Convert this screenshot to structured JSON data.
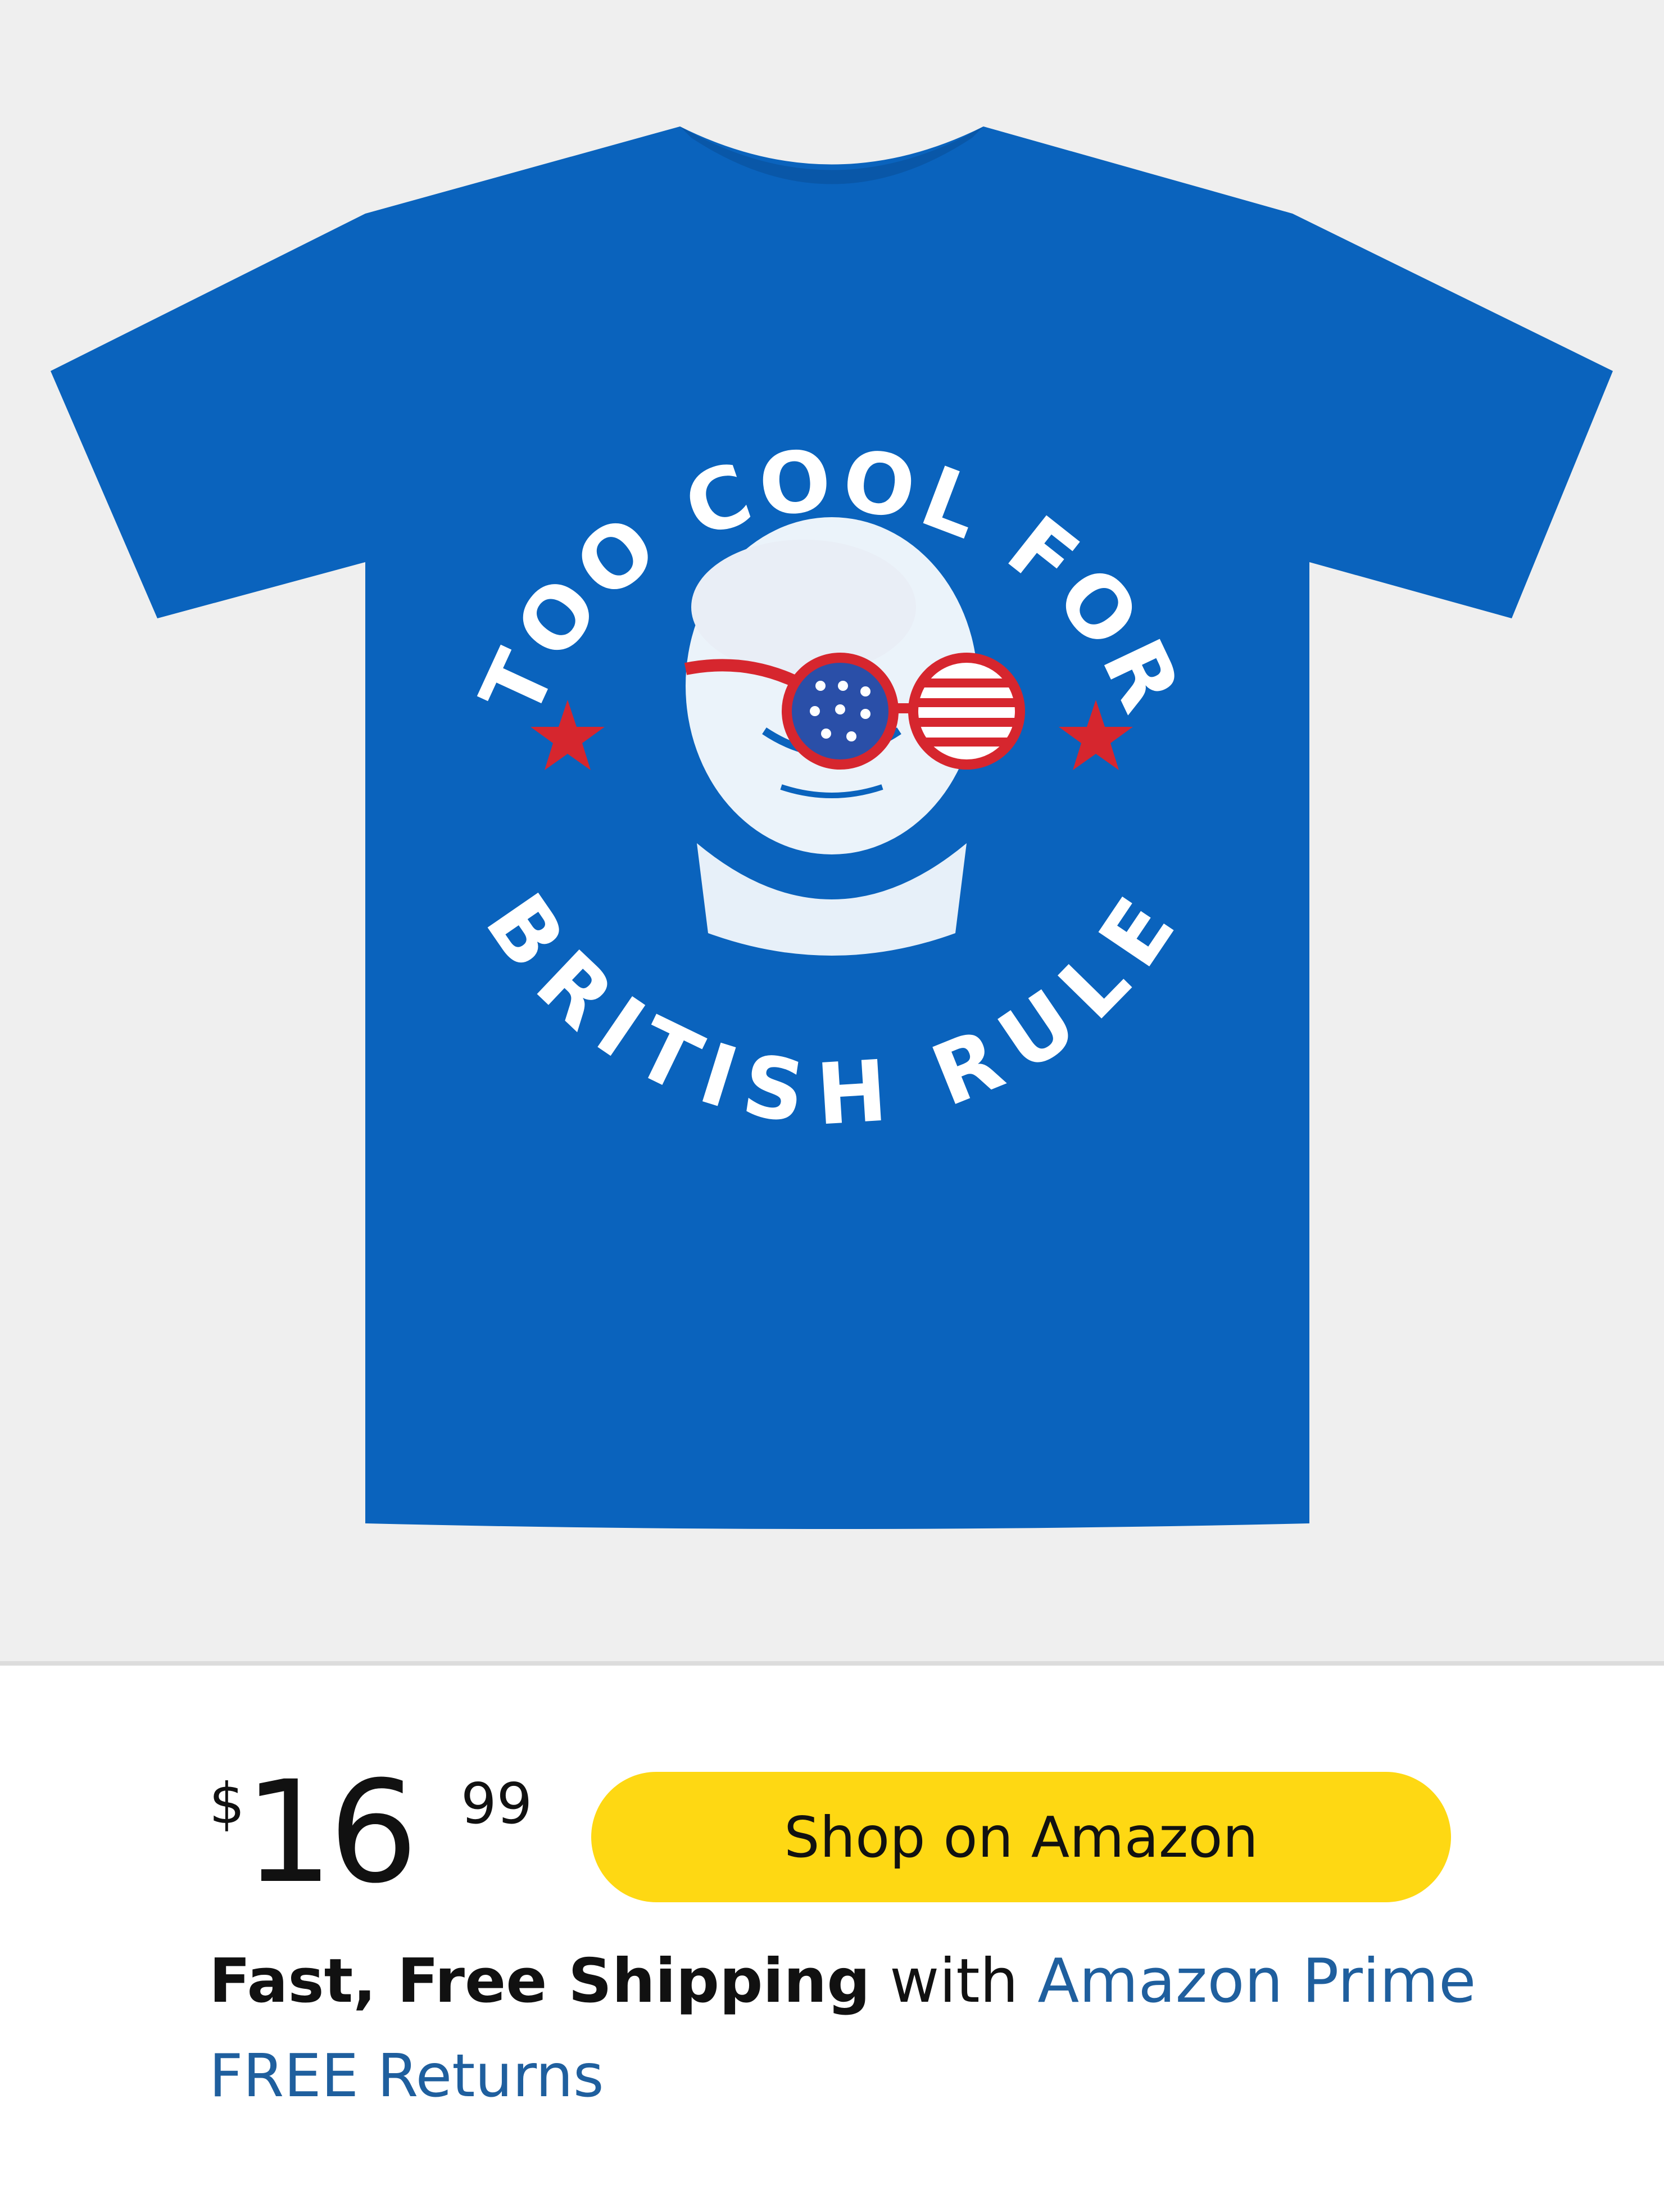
{
  "product": {
    "image_alt": "Too Cool For British Rule t-shirt",
    "shirt_color": "#0a63bd",
    "background_color": "#efefef",
    "print": {
      "top_text": "TOO COOL FOR",
      "bottom_text": "BRITISH RULE",
      "star_color": "#d6262e",
      "text_color": "#ffffff"
    }
  },
  "price": {
    "symbol": "$",
    "whole": "16",
    "fraction": "99"
  },
  "buy_button": {
    "label": "Shop on Amazon",
    "color": "#fed813"
  },
  "shipping": {
    "bold": "Fast, Free Shipping",
    "with": " with ",
    "prime": "Amazon Prime",
    "link_color": "#1f5f9e"
  },
  "returns": {
    "label": "FREE Returns"
  }
}
